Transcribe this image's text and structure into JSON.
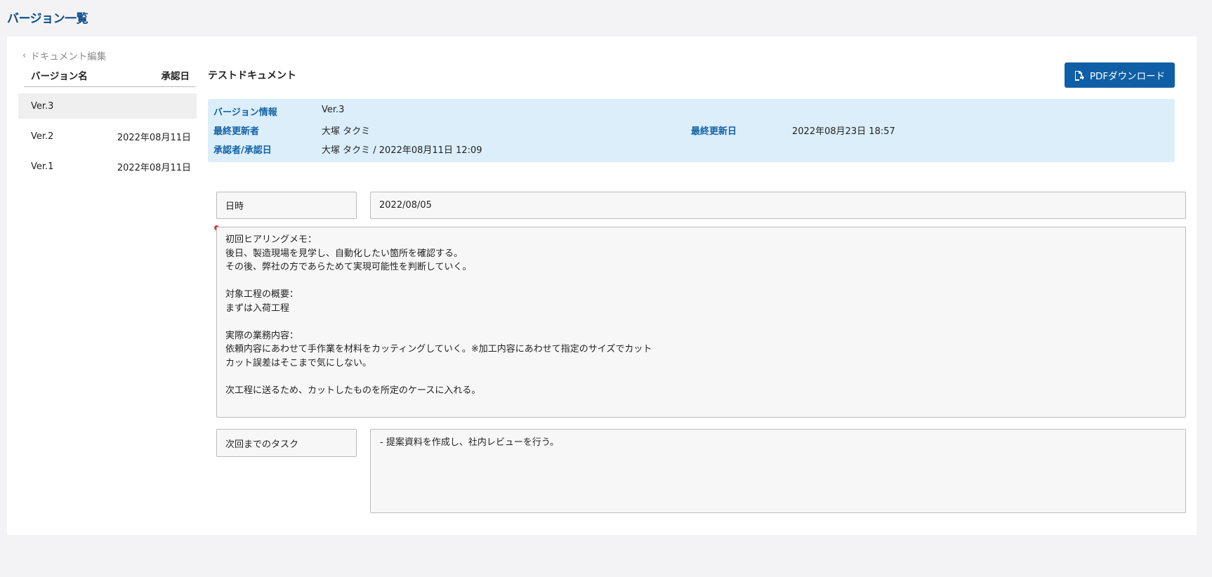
{
  "page": {
    "title": "バージョン一覧"
  },
  "sidebar": {
    "back_label": "ドキュメント編集",
    "header_name": "バージョン名",
    "header_date": "承認日",
    "versions": [
      {
        "name": "Ver.3",
        "date": "",
        "selected": true
      },
      {
        "name": "Ver.2",
        "date": "2022年08月11日",
        "selected": false
      },
      {
        "name": "Ver.1",
        "date": "2022年08月11日",
        "selected": false
      }
    ]
  },
  "document": {
    "title": "テストドキュメント",
    "pdf_button_label": "PDFダウンロード",
    "info": {
      "version_label": "バージョン情報",
      "version_value": "Ver.3",
      "updater_label": "最終更新者",
      "updater_value": "大塚 タクミ",
      "updated_at_label": "最終更新日",
      "updated_at_value": "2022年08月23日 18:57",
      "approver_label": "承認者/承認日",
      "approver_value": "大塚 タクミ / 2022年08月11日 12:09"
    },
    "fields": {
      "date_label": "日時",
      "date_value": "2022/08/05",
      "memo_value": "初回ヒアリングメモ：\n後日、製造現場を見学し、自動化したい箇所を確認する。\nその後、弊社の方であらためて実現可能性を判断していく。\n\n対象工程の概要：\nまずは入荷工程\n\n実際の業務内容：\n依頼内容にあわせて手作業を材料をカッティングしていく。※加工内容にあわせて指定のサイズでカット\nカット誤差はそこまで気にしない。\n\n次工程に送るため、カットしたものを所定のケースに入れる。",
      "task_label": "次回までのタスク",
      "task_value": "- 提案資料を作成し、社内レビューを行う。"
    }
  },
  "colors": {
    "accent": "#0f5fa6",
    "title": "#0f4d8c",
    "info_bg": "#dbeefa",
    "required_dot": "#d33a3a"
  }
}
